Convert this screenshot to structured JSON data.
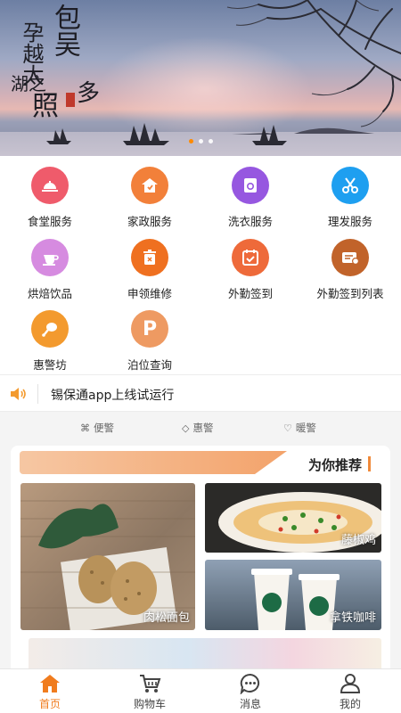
{
  "banner": {
    "calligraphy_line1": "包吴",
    "calligraphy_line2": "孕越太",
    "calligraphy_line3": "湖之",
    "calligraphy_line4": "照",
    "calligraphy_line5": "多"
  },
  "services": [
    {
      "label": "食堂服务",
      "icon": "cloche-icon",
      "color": "#ef5b6b"
    },
    {
      "label": "家政服务",
      "icon": "house-icon",
      "color": "#f2803a"
    },
    {
      "label": "洗衣服务",
      "icon": "washing-machine-icon",
      "color": "#9657e0"
    },
    {
      "label": "理发服务",
      "icon": "scissors-icon",
      "color": "#1e9ff0"
    },
    {
      "label": "烘焙饮品",
      "icon": "coffee-cup-icon",
      "color": "#d68be0"
    },
    {
      "label": "申领维修",
      "icon": "trash-can-icon",
      "color": "#ef7020"
    },
    {
      "label": "外勤签到",
      "icon": "calendar-check-icon",
      "color": "#ee6a3a"
    },
    {
      "label": "外勤签到列表",
      "icon": "list-card-icon",
      "color": "#c1632a"
    },
    {
      "label": "惠警坊",
      "icon": "chicken-leg-icon",
      "color": "#f39a2e"
    },
    {
      "label": "泊位查询",
      "icon": "parking-icon",
      "color": "#ee9a62"
    }
  ],
  "notice": {
    "text": "锡保通app上线试运行"
  },
  "tags": [
    {
      "label": "便警",
      "icon": "command-icon"
    },
    {
      "label": "惠警",
      "icon": "tag-icon"
    },
    {
      "label": "暖警",
      "icon": "heart-icon"
    }
  ],
  "recommend": {
    "title": "为你推荐",
    "items": [
      {
        "caption": "肉松面包"
      },
      {
        "caption": "藤椒鸡"
      },
      {
        "caption": "拿铁咖啡"
      }
    ]
  },
  "nav": [
    {
      "label": "首页",
      "icon": "home-icon",
      "active": true
    },
    {
      "label": "购物车",
      "icon": "cart-icon",
      "active": false
    },
    {
      "label": "消息",
      "icon": "message-icon",
      "active": false
    },
    {
      "label": "我的",
      "icon": "user-icon",
      "active": false
    }
  ],
  "colors": {
    "accent": "#f07c1e"
  }
}
